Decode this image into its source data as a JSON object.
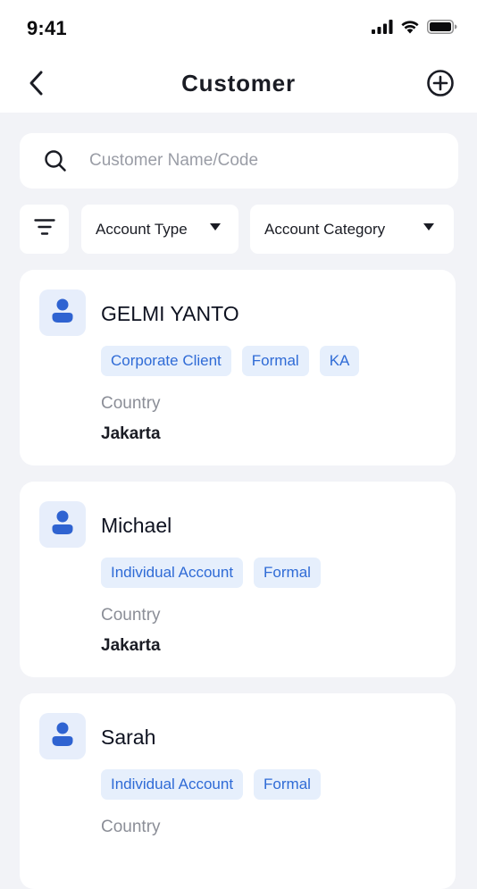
{
  "status_bar": {
    "time": "9:41",
    "icons": [
      "signal-icon",
      "wifi-icon",
      "battery-icon"
    ]
  },
  "nav": {
    "back_icon": "chevron-left-icon",
    "title": "Customer",
    "add_icon": "plus-circle-icon"
  },
  "search": {
    "icon": "search-icon",
    "placeholder": "Customer Name/Code",
    "value": ""
  },
  "filters": {
    "filter_icon": "filter-icon",
    "account_type_label": "Account Type",
    "account_category_label": "Account Category"
  },
  "customers": [
    {
      "name": "GELMI YANTO",
      "tags": [
        "Corporate Client",
        "Formal",
        "KA"
      ],
      "field_label": "Country",
      "field_value": "Jakarta"
    },
    {
      "name": "Michael",
      "tags": [
        "Individual Account",
        "Formal"
      ],
      "field_label": "Country",
      "field_value": "Jakarta"
    },
    {
      "name": "Sarah",
      "tags": [
        "Individual Account",
        "Formal"
      ],
      "field_label": "Country",
      "field_value": ""
    }
  ],
  "colors": {
    "background": "#F2F3F7",
    "card": "#FFFFFF",
    "accent": "#2F6BD6",
    "tag_bg": "#E6EFFC",
    "avatar_bg": "#E7EEFB",
    "avatar_fg": "#2F63D1"
  }
}
